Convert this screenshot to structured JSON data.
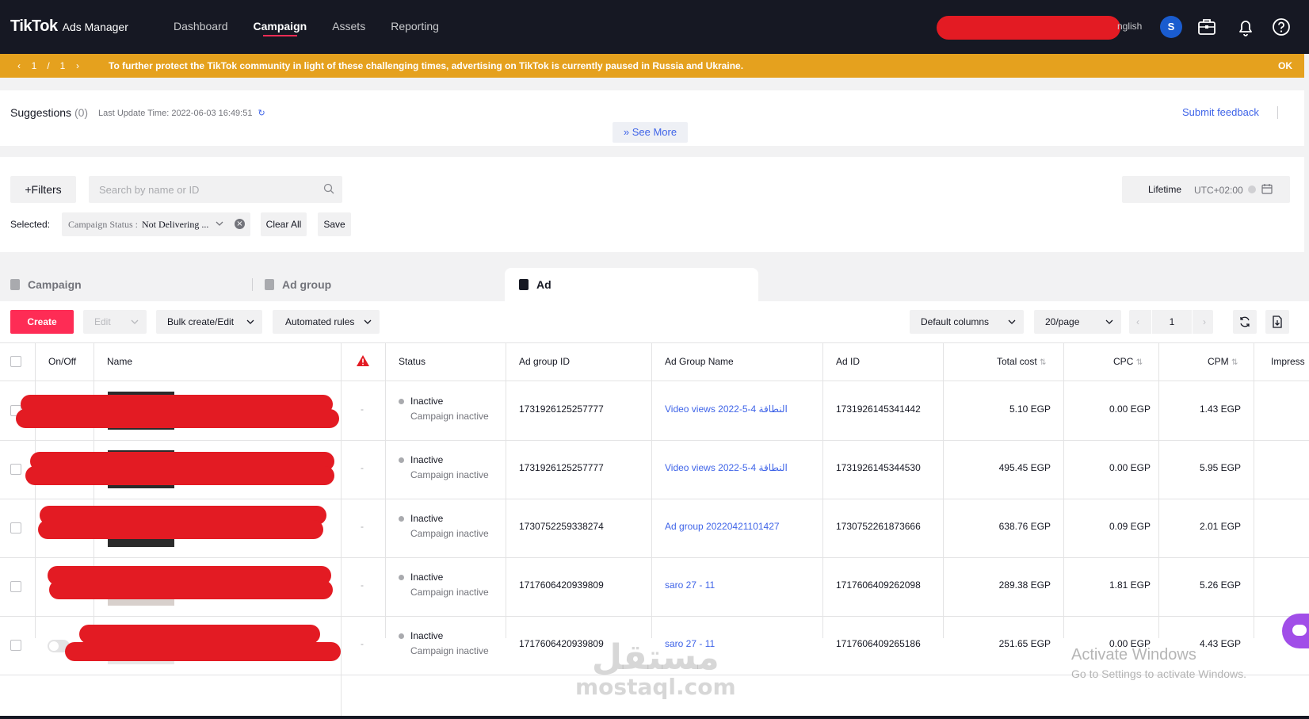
{
  "colors": {
    "accent": "#fe2c55",
    "link": "#3f64e8",
    "notice_bg": "#e5a11e",
    "topbar_bg": "#161823",
    "redaction": "#e31b23"
  },
  "app": {
    "brand": "TikTok",
    "product": "Ads Manager"
  },
  "nav": {
    "items": [
      {
        "label": "Dashboard",
        "active": false
      },
      {
        "label": "Campaign",
        "active": true
      },
      {
        "label": "Assets",
        "active": false
      },
      {
        "label": "Reporting",
        "active": false
      }
    ],
    "language": "nglish",
    "avatar_letter": "S",
    "icons": [
      "briefcase-icon",
      "bell-icon",
      "help-icon"
    ]
  },
  "notice": {
    "page_current": "1",
    "page_sep": "/",
    "page_total": "1",
    "message": "To further protect the TikTok community in light of these challenging times, advertising on TikTok is currently paused in Russia and Ukraine.",
    "ok_label": "OK"
  },
  "suggestions": {
    "title": "Suggestions",
    "count": "(0)",
    "last_update": "Last Update Time: 2022-06-03 16:49:51",
    "feedback_label": "Submit feedback",
    "see_more_label": "See More"
  },
  "filters": {
    "filters_label": "Filters",
    "search_placeholder": "Search by name or ID",
    "date_label": "Lifetime",
    "timezone": "UTC+02:00",
    "selected_label": "Selected:",
    "tag_key": "Campaign Status :",
    "tag_value": "Not Delivering ...",
    "clear_all_label": "Clear All",
    "save_label": "Save"
  },
  "levels": {
    "campaign": "Campaign",
    "ad_group": "Ad group",
    "ad": "Ad",
    "active": "ad"
  },
  "toolbar": {
    "create_label": "Create",
    "edit_label": "Edit",
    "bulk_label": "Bulk create/Edit",
    "rules_label": "Automated rules",
    "columns_label": "Default columns",
    "page_size_label": "20/page",
    "page_number": "1"
  },
  "table": {
    "headers": {
      "onoff": "On/Off",
      "name": "Name",
      "status": "Status",
      "adgroup_id": "Ad group ID",
      "adgroup_name": "Ad Group Name",
      "ad_id": "Ad ID",
      "total_cost": "Total cost",
      "cpc": "CPC",
      "cpm": "CPM",
      "impressions": "Impress"
    },
    "rows": [
      {
        "dash": "-",
        "status": "Inactive",
        "status_sub": "Campaign inactive",
        "adgroup_id": "1731926125257777",
        "adgroup_name": "Video views 2022-5-4 النطاقة",
        "ad_id": "1731926145341442",
        "total_cost": "5.10 EGP",
        "cpc": "0.00 EGP",
        "cpm": "1.43 EGP"
      },
      {
        "dash": "-",
        "status": "Inactive",
        "status_sub": "Campaign inactive",
        "adgroup_id": "1731926125257777",
        "adgroup_name": "Video views 2022-5-4 النطاقة",
        "ad_id": "1731926145344530",
        "total_cost": "495.45 EGP",
        "cpc": "0.00 EGP",
        "cpm": "5.95 EGP"
      },
      {
        "dash": "-",
        "status": "Inactive",
        "status_sub": "Campaign inactive",
        "adgroup_id": "1730752259338274",
        "adgroup_name": "Ad group 20220421101427",
        "ad_id": "1730752261873666",
        "total_cost": "638.76 EGP",
        "cpc": "0.09 EGP",
        "cpm": "2.01 EGP"
      },
      {
        "dash": "-",
        "status": "Inactive",
        "status_sub": "Campaign inactive",
        "adgroup_id": "1717606420939809",
        "adgroup_name": "saro 27 - 11",
        "ad_id": "1717606409262098",
        "total_cost": "289.38 EGP",
        "cpc": "1.81 EGP",
        "cpm": "5.26 EGP"
      },
      {
        "dash": "-",
        "status": "Inactive",
        "status_sub": "Campaign inactive",
        "adgroup_id": "1717606420939809",
        "adgroup_name": "saro 27 - 11",
        "ad_id": "1717606409265186",
        "total_cost": "251.65 EGP",
        "cpc": "0.00 EGP",
        "cpm": "4.43 EGP"
      }
    ]
  },
  "overlay": {
    "watermark_ar": "مستقل",
    "watermark_en": "mostaql.com",
    "activate_title": "Activate Windows",
    "activate_sub": "Go to Settings to activate Windows."
  }
}
